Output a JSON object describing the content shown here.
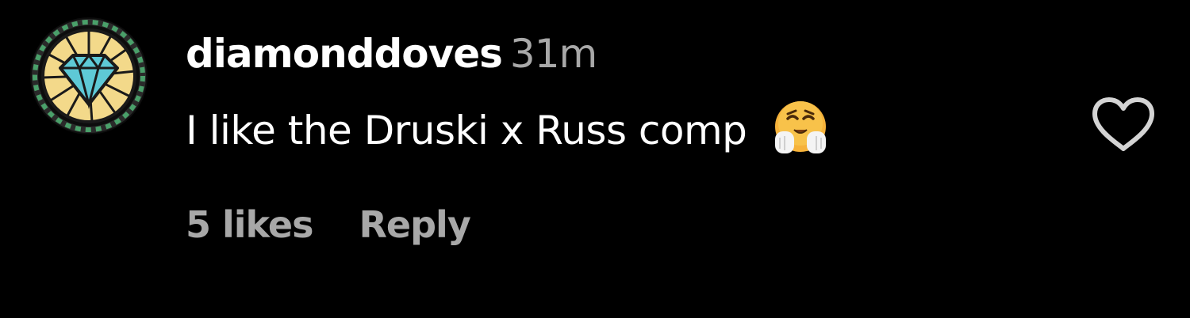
{
  "comment": {
    "username": "diamonddoves",
    "timestamp": "31m",
    "text": "I like the Druski x Russ comp",
    "emoji": "hugging-face-emoji",
    "likes_label": "5 likes",
    "likes_count": 5,
    "reply_label": "Reply",
    "liked": false
  },
  "icons": {
    "avatar": "diamond-avatar",
    "like": "heart-outline-icon"
  },
  "colors": {
    "background": "#000000",
    "primary_text": "#ffffff",
    "secondary_text": "#a8a8a8",
    "avatar_diamond": "#5ec9d6",
    "avatar_rays": "#f3d98a",
    "avatar_ring": "#3c8a5a",
    "emoji_face": "#f6b23a"
  }
}
